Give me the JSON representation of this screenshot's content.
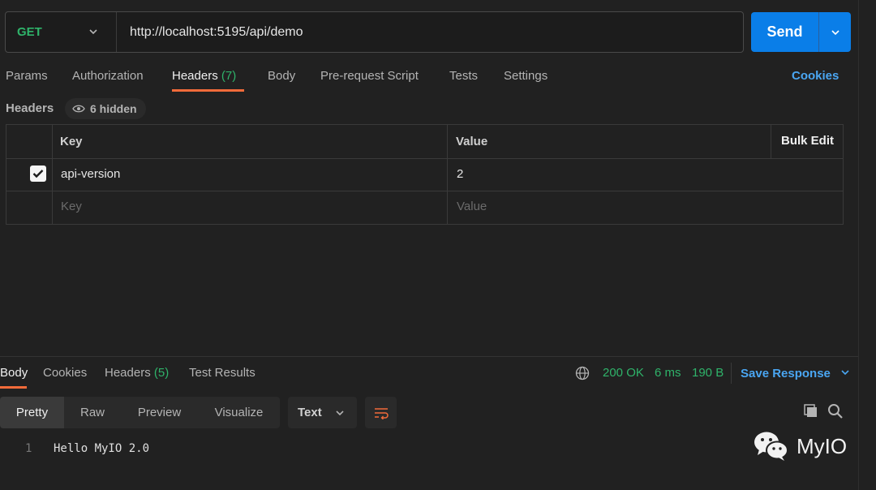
{
  "request": {
    "method": "GET",
    "url": "http://localhost:5195/api/demo",
    "send_label": "Send"
  },
  "request_tabs": [
    {
      "label": "Params"
    },
    {
      "label": "Authorization"
    },
    {
      "label": "Headers",
      "count": "(7)",
      "active": true
    },
    {
      "label": "Body"
    },
    {
      "label": "Pre-request Script"
    },
    {
      "label": "Tests"
    },
    {
      "label": "Settings"
    }
  ],
  "cookies_link": "Cookies",
  "headers_section": {
    "title": "Headers",
    "hidden_label": "6 hidden",
    "columns": {
      "key": "Key",
      "value": "Value",
      "bulk_edit": "Bulk Edit"
    },
    "rows": [
      {
        "key": "api-version",
        "value": "2",
        "enabled": true
      }
    ],
    "placeholder": {
      "key": "Key",
      "value": "Value"
    }
  },
  "response_tabs": [
    {
      "label": "Body",
      "active": true
    },
    {
      "label": "Cookies"
    },
    {
      "label": "Headers",
      "count": "(5)"
    },
    {
      "label": "Test Results"
    }
  ],
  "response_status": {
    "status": "200 OK",
    "time": "6 ms",
    "size": "190 B"
  },
  "save_response": "Save Response",
  "view_modes": [
    "Pretty",
    "Raw",
    "Preview",
    "Visualize"
  ],
  "format": "Text",
  "body": {
    "line_number": "1",
    "text": "Hello MyIO 2.0"
  },
  "watermark": "MyIO",
  "colors": {
    "accent": "#f26b3a",
    "send": "#0a7ee8",
    "success": "#2fb36a",
    "link": "#4aa6f2"
  }
}
